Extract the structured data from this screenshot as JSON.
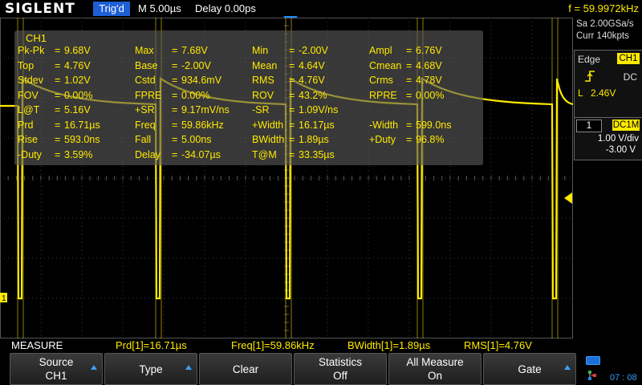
{
  "topbar": {
    "brand": "SIGLENT",
    "trigger_status": "Trig'd",
    "timebase": "M 5.00µs",
    "delay": "Delay 0.00ps",
    "frequency": "f = 59.9972kHz"
  },
  "measurements": {
    "channel": "CH1",
    "rows": [
      [
        {
          "name": "Pk-Pk",
          "value": "9.68V"
        },
        {
          "name": "Max",
          "value": "7.68V"
        },
        {
          "name": "Min",
          "value": "-2.00V"
        },
        {
          "name": "Ampl",
          "value": "6.76V"
        }
      ],
      [
        {
          "name": "Top",
          "value": "4.76V"
        },
        {
          "name": "Base",
          "value": "-2.00V"
        },
        {
          "name": "Mean",
          "value": "4.64V"
        },
        {
          "name": "Cmean",
          "value": "4.68V"
        }
      ],
      [
        {
          "name": "Stdev",
          "value": "1.02V"
        },
        {
          "name": "Cstd",
          "value": "934.6mV"
        },
        {
          "name": "RMS",
          "value": "4.76V"
        },
        {
          "name": "Crms",
          "value": "4.78V"
        }
      ],
      [
        {
          "name": "FOV",
          "value": "0.00%"
        },
        {
          "name": "FPRE",
          "value": "0.00%"
        },
        {
          "name": "ROV",
          "value": "43.2%"
        },
        {
          "name": "RPRE",
          "value": "0.00%"
        }
      ],
      [
        {
          "name": "L@T",
          "value": "5.16V"
        },
        {
          "name": "+SR",
          "value": "9.17mV/ns"
        },
        {
          "name": "-SR",
          "value": "1.09V/ns"
        }
      ],
      [
        {
          "name": "Prd",
          "value": "16.71µs"
        },
        {
          "name": "Freq",
          "value": "59.86kHz"
        },
        {
          "name": "+Width",
          "value": "16.17µs"
        },
        {
          "name": "-Width",
          "value": "599.0ns"
        }
      ],
      [
        {
          "name": "Rise",
          "value": "593.0ns"
        },
        {
          "name": "Fall",
          "value": "5.00ns"
        },
        {
          "name": "BWidth",
          "value": "1.89µs"
        },
        {
          "name": "+Duty",
          "value": "96.8%"
        }
      ],
      [
        {
          "name": "-Duty",
          "value": "3.59%"
        },
        {
          "name": "Delay",
          "value": "-34.07µs"
        },
        {
          "name": "T@M",
          "value": "33.35µs"
        }
      ]
    ]
  },
  "right_panel": {
    "sample_rate": "Sa 2.00GSa/s",
    "memory": "Curr 140kpts",
    "trigger": {
      "type": "Edge",
      "source": "CH1",
      "coupling": "DC",
      "level_label": "L",
      "level": "2.46V"
    },
    "channel": {
      "number": "1",
      "coupling": "DC1M",
      "scale": "1.00 V/div",
      "offset": "-3.00 V"
    },
    "clock": "07 : 08"
  },
  "measure_strip": {
    "title": "MEASURE",
    "items": [
      "Prd[1]=16.71µs",
      "Freq[1]=59.86kHz",
      "BWidth[1]=1.89µs",
      "RMS[1]=4.76V"
    ]
  },
  "softkeys": [
    {
      "line1": "Source",
      "line2": "CH1",
      "arrow": true
    },
    {
      "line1": "",
      "line2": "",
      "single": "Type",
      "arrow": true
    },
    {
      "line1": "",
      "line2": "",
      "single": "Clear",
      "arrow": false
    },
    {
      "line1": "Statistics",
      "line2": "Off",
      "arrow": false
    },
    {
      "line1": "All Measure",
      "line2": "On",
      "arrow": false
    },
    {
      "line1": "",
      "line2": "",
      "single": "Gate",
      "arrow": true
    }
  ],
  "colors": {
    "trace": "#ffea00",
    "accent": "#1e8cff",
    "grid": "#3a3a3a"
  },
  "icons": [
    "trigger-position-icon",
    "rising-edge-icon",
    "ground-marker-icon",
    "trigger-level-marker-icon",
    "battery-icon",
    "usb-icon"
  ]
}
